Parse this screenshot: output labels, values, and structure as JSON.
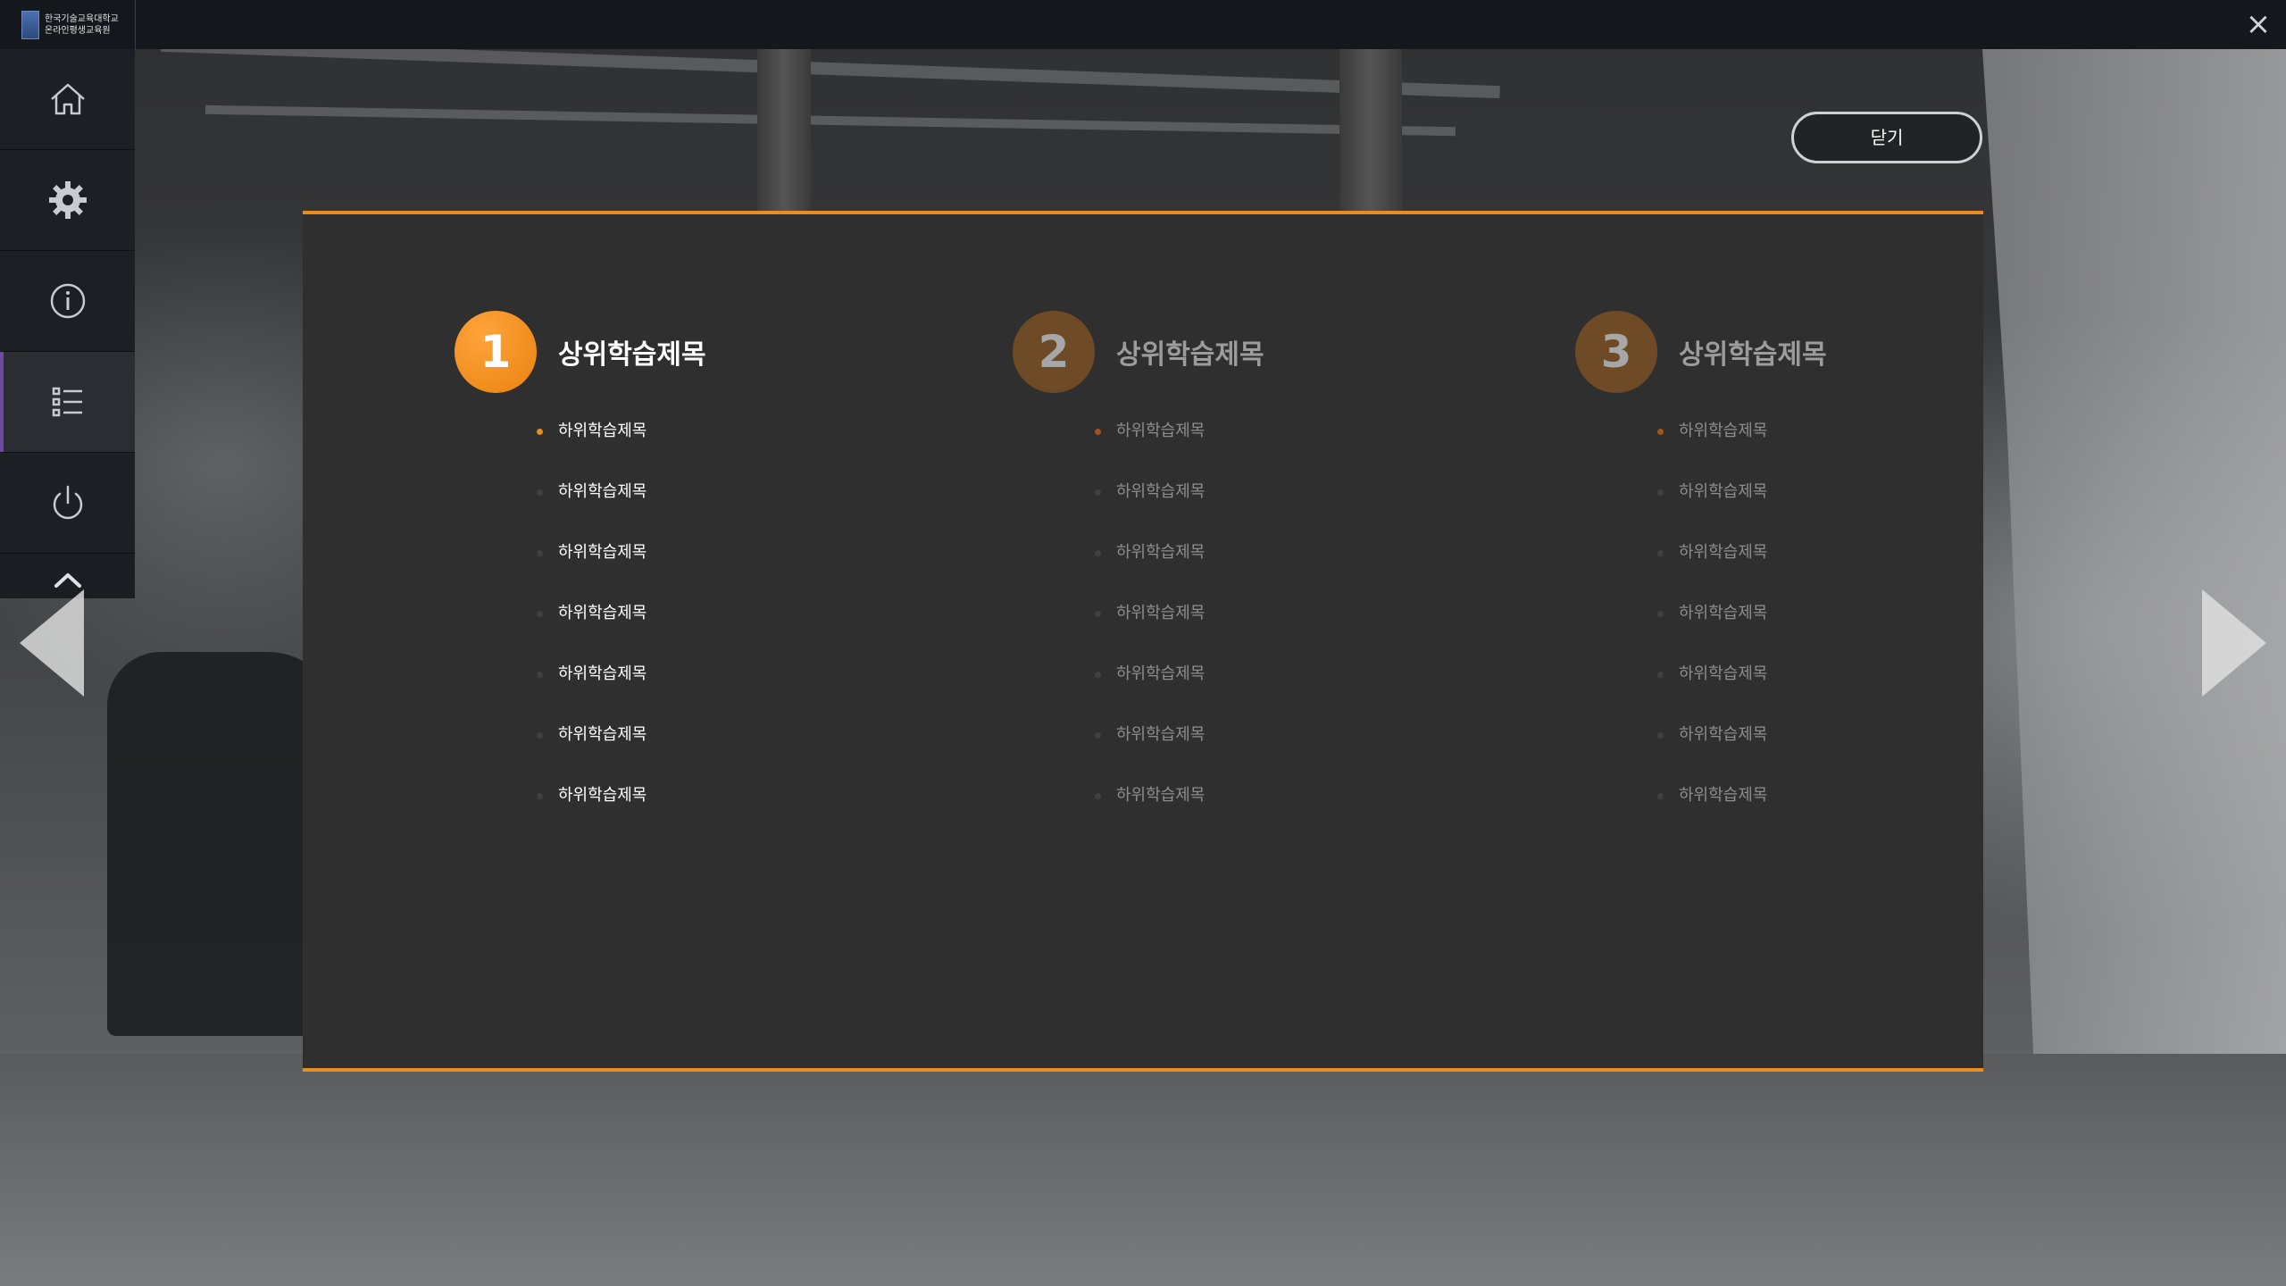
{
  "header": {
    "logo_line1": "한국기술교육대학교",
    "logo_line2": "온라인평생교육원",
    "close_icon": "×"
  },
  "sidebar": {
    "items": [
      {
        "icon": "home-icon"
      },
      {
        "icon": "gear-icon"
      },
      {
        "icon": "info-icon"
      },
      {
        "icon": "list-icon",
        "active": true
      },
      {
        "icon": "power-icon"
      }
    ],
    "collapse_icon": "chevron-up-icon"
  },
  "close_button_label": "닫기",
  "columns": [
    {
      "number": "1",
      "title": "상위학습제목",
      "active": true,
      "items": [
        "하위학습제목",
        "하위학습제목",
        "하위학습제목",
        "하위학습제목",
        "하위학습제목",
        "하위학습제목",
        "하위학습제목"
      ]
    },
    {
      "number": "2",
      "title": "상위학습제목",
      "active": false,
      "items": [
        "하위학습제목",
        "하위학습제목",
        "하위학습제목",
        "하위학습제목",
        "하위학습제목",
        "하위학습제목",
        "하위학습제목"
      ]
    },
    {
      "number": "3",
      "title": "상위학습제목",
      "active": false,
      "items": [
        "하위학습제목",
        "하위학습제목",
        "하위학습제목",
        "하위학습제목",
        "하위학습제목",
        "하위학습제목",
        "하위학습제목"
      ]
    }
  ],
  "colors": {
    "accent": "#e98d20",
    "panel": "#2f2f30",
    "sidebar": "#1a1d21",
    "active_indicator": "#6d4ba3"
  }
}
